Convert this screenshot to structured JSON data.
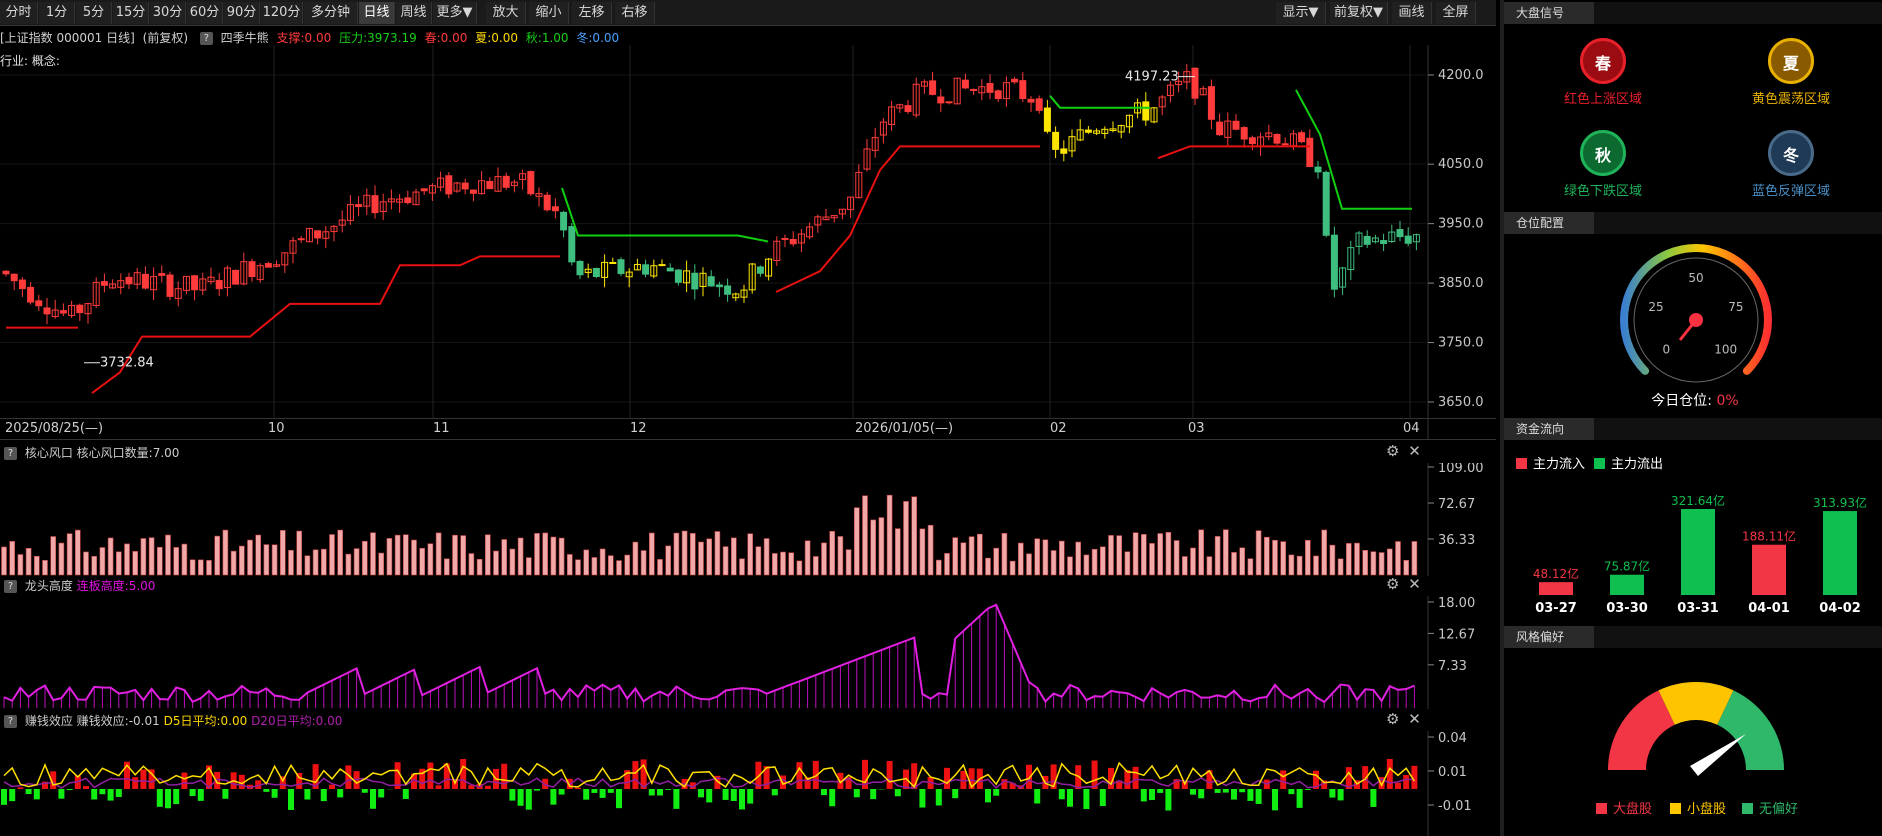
{
  "toolbar": {
    "periods": [
      "分时",
      "1分",
      "5分",
      "15分",
      "30分",
      "60分",
      "90分",
      "120分",
      "多分钟",
      "日线",
      "周线",
      "更多▼"
    ],
    "active_period": "日线",
    "actions": [
      "放大",
      "缩小",
      "左移",
      "右移"
    ],
    "right_buttons": [
      "显示▼",
      "前复权▼",
      "画线",
      "全屏"
    ]
  },
  "info": {
    "symbol": "[上证指数 000001 日线]",
    "adjust": "(前复权)",
    "help": "?",
    "indicator": "四季牛熊",
    "support": "支撑:0.00",
    "pressure": "压力:3973.19",
    "spring": "春:0.00",
    "summer": "夏:0.00",
    "autumn": "秋:1.00",
    "winter": "冬:0.00",
    "industry": "行业: 概念:"
  },
  "main_chart": {
    "y_ticks": [
      "4200.0",
      "4050.0",
      "3950.0",
      "3850.0",
      "3750.0",
      "3650.0"
    ],
    "high_label": "4197.23",
    "low_label": "3732.84",
    "x_labels": [
      "2025/08/25(—)",
      "10",
      "11",
      "12",
      "2026/01/05(—)",
      "02",
      "03",
      "04"
    ]
  },
  "panel1": {
    "title": "核心风口",
    "value_label": "核心风口数量:7.00",
    "y_ticks": [
      "109.00",
      "72.67",
      "36.33"
    ]
  },
  "panel2": {
    "title": "龙头高度",
    "value_label": "连板高度:5.00",
    "y_ticks": [
      "18.00",
      "12.67",
      "7.33"
    ]
  },
  "panel3": {
    "title": "赚钱效应",
    "value_label": "赚钱效应:-0.01",
    "d5_label": "D5日平均:0.00",
    "d20_label": "D20日平均:0.00",
    "y_ticks": [
      "0.04",
      "0.01",
      "-0.01"
    ]
  },
  "sidebar": {
    "signal_title": "大盘信号",
    "seasons": [
      {
        "char": "春",
        "label": "红色上涨区域",
        "color": "#e8202a"
      },
      {
        "char": "夏",
        "label": "黄色震荡区域",
        "color": "#e8b000"
      },
      {
        "char": "秋",
        "label": "绿色下跌区域",
        "color": "#1fb35a"
      },
      {
        "char": "冬",
        "label": "蓝色反弹区域",
        "color": "#4a90c8"
      }
    ],
    "position_title": "仓位配置",
    "gauge_ticks": [
      "0",
      "25",
      "50",
      "75",
      "100"
    ],
    "today_position_label": "今日仓位:",
    "today_position_value": "0%",
    "flow_title": "资金流向",
    "flow_in_label": "主力流入",
    "flow_out_label": "主力流出",
    "style_title": "风格偏好",
    "style_legend": [
      "大盘股",
      "小盘股",
      "无偏好"
    ]
  },
  "chart_data": [
    {
      "type": "bar",
      "title": "资金流向",
      "categories": [
        "03-27",
        "03-30",
        "03-31",
        "04-01",
        "04-02"
      ],
      "values": [
        48.12,
        75.87,
        321.64,
        188.11,
        313.93
      ],
      "value_labels": [
        "48.12亿",
        "75.87亿",
        "321.64亿",
        "188.11亿",
        "313.93亿"
      ],
      "directions": [
        "in",
        "out",
        "out",
        "in",
        "out"
      ],
      "colors": {
        "in": "#f23645",
        "out": "#0fbf4f"
      }
    }
  ]
}
